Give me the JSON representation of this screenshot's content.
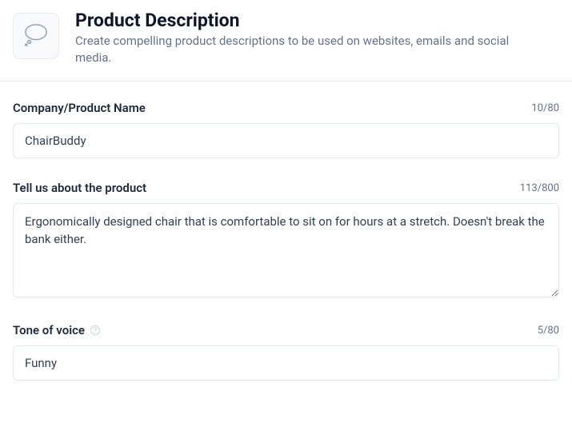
{
  "header": {
    "title": "Product Description",
    "subtitle": "Create compelling product descriptions to be used on websites, emails and social media.",
    "icon": "thought-bubble-icon"
  },
  "fields": {
    "product_name": {
      "label": "Company/Product Name",
      "value": "ChairBuddy",
      "count": "10/80"
    },
    "about": {
      "label": "Tell us about the product",
      "value": "Ergonomically designed chair that is comfortable to sit on for hours at a stretch. Doesn't break the bank either.",
      "count": "113/800"
    },
    "tone": {
      "label": "Tone of voice",
      "value": "Funny",
      "count": "5/80"
    }
  }
}
